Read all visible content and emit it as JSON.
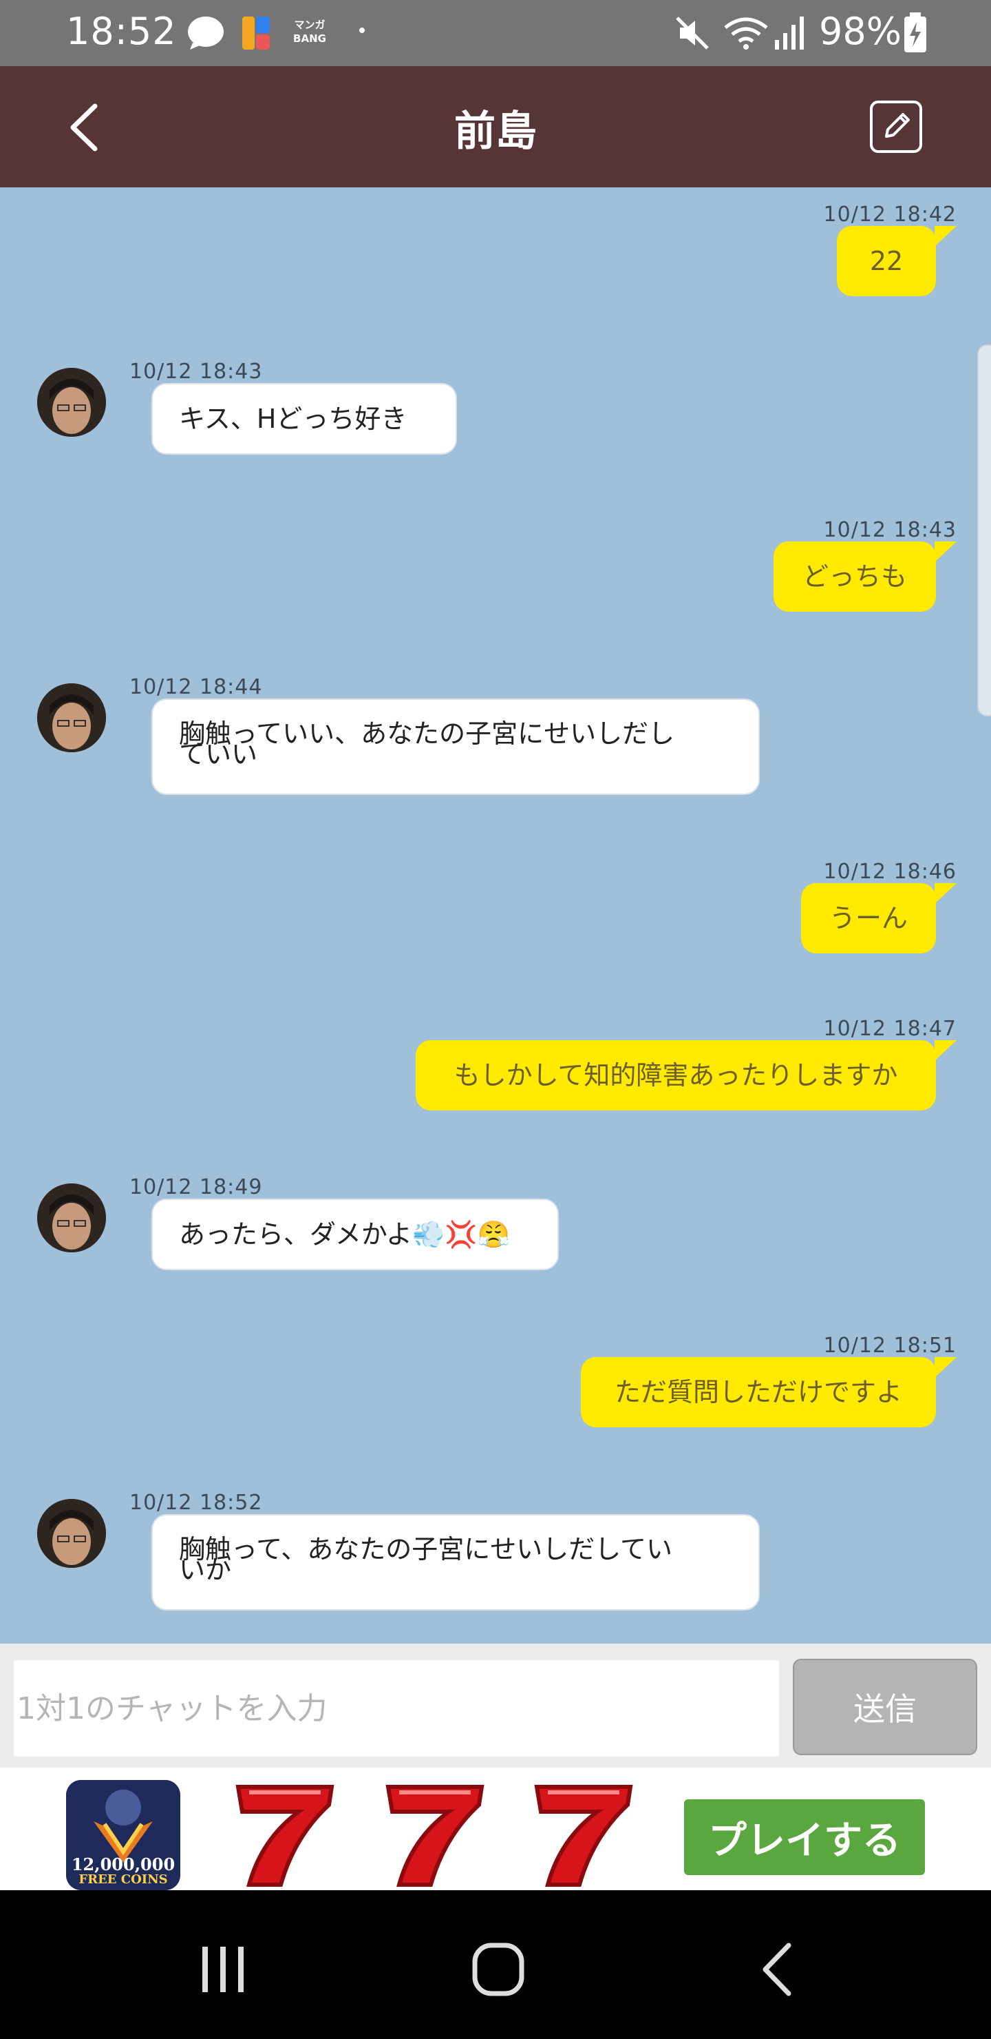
{
  "status_bar": {
    "time": "18:52",
    "manga_label_top": "マンガ",
    "manga_label_bottom": "BANG",
    "battery": "98%",
    "icons": [
      "chat-bubble-icon",
      "app-icon",
      "manga-bang-icon",
      "mute-icon",
      "wifi-icon",
      "signal-icon",
      "battery-charging-icon"
    ]
  },
  "header": {
    "title": "前島",
    "background": "#553536"
  },
  "messages": [
    {
      "side": "me",
      "time": "10/12 18:42",
      "text": "22"
    },
    {
      "side": "them",
      "time": "10/12 18:43",
      "text": "キス、Hどっち好き"
    },
    {
      "side": "me",
      "time": "10/12 18:43",
      "text": "どっちも"
    },
    {
      "side": "them",
      "time": "10/12 18:44",
      "text_lines": [
        "胸触っていい、あなたの子宮にせいしだし",
        "ていい"
      ]
    },
    {
      "side": "me",
      "time": "10/12 18:46",
      "text": "うーん"
    },
    {
      "side": "me",
      "time": "10/12 18:47",
      "text": "もしかして知的障害あったりしますか"
    },
    {
      "side": "them",
      "time": "10/12 18:49",
      "text": "あったら、ダメかよ💨💢😤"
    },
    {
      "side": "me",
      "time": "10/12 18:51",
      "text": "ただ質問しただけですよ"
    },
    {
      "side": "them",
      "time": "10/12 18:52",
      "text_lines": [
        "胸触って、あなたの子宮にせいしだしてい",
        "いか"
      ]
    }
  ],
  "input": {
    "placeholder": "1対1のチャットを入力",
    "send_label": "送信"
  },
  "ad": {
    "icon_amount": "12,000,000",
    "icon_caption": "FREE COINS",
    "cta_label": "プレイする",
    "sevens": [
      "7",
      "7",
      "7"
    ]
  },
  "colors": {
    "chat_background": "#a0bfd9",
    "my_bubble": "#ffea00",
    "their_bubble": "#ffffff",
    "cta": "#5aa63f"
  }
}
